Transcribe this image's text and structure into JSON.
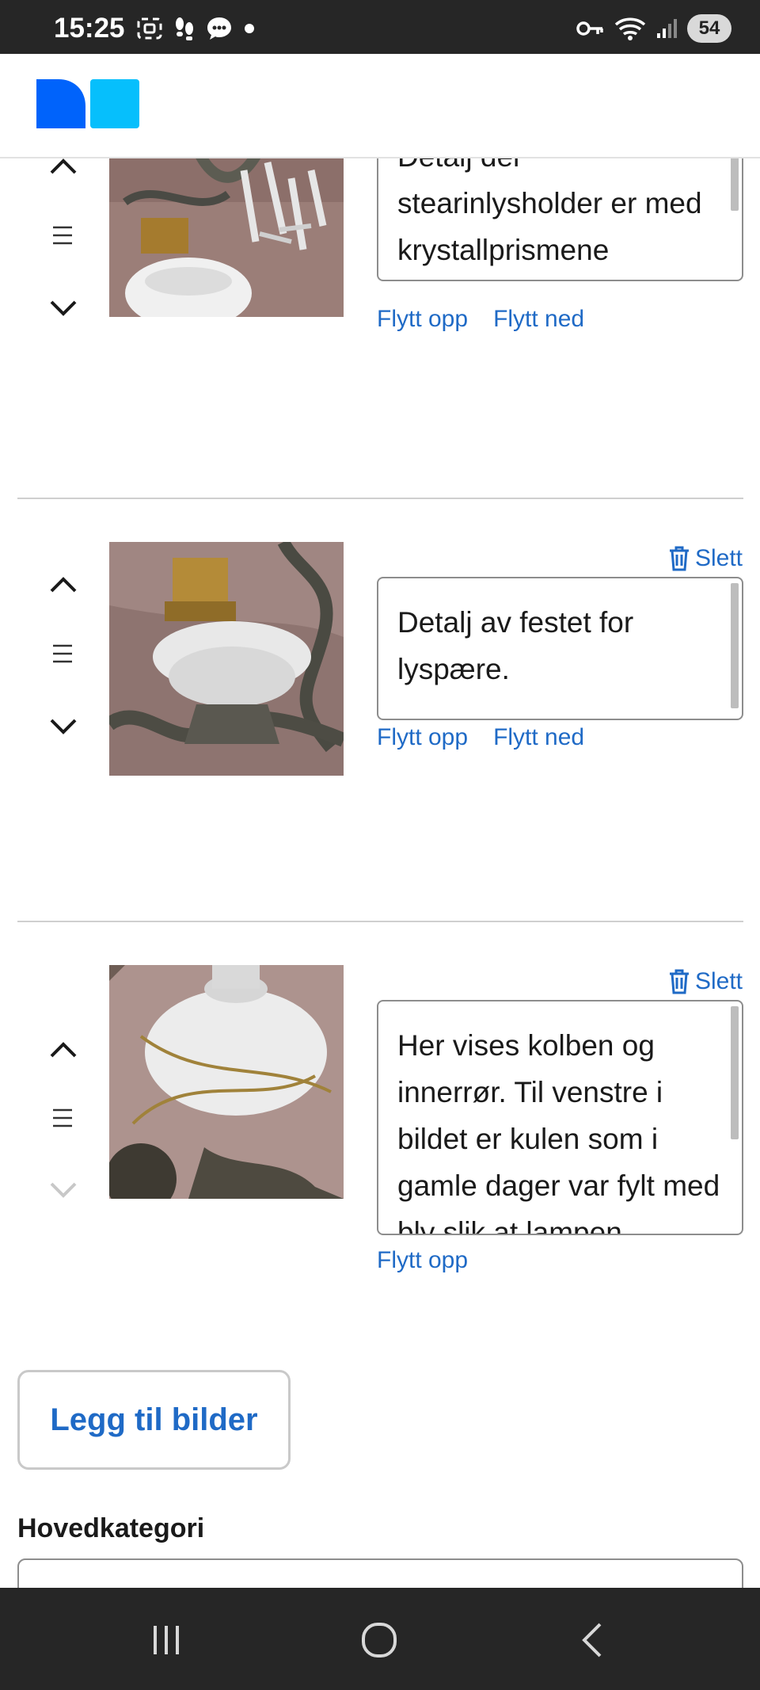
{
  "status_bar": {
    "time": "15:25",
    "battery": "54",
    "icons_left": [
      "screenshot-icon",
      "footsteps-icon",
      "chat-icon",
      "dot-icon"
    ],
    "icons_right": [
      "vpn-key-icon",
      "wifi-icon",
      "signal-icon",
      "battery-icon"
    ]
  },
  "header": {
    "logo_colors": [
      "#0063fb",
      "#06bffc"
    ]
  },
  "images": [
    {
      "caption": "Detalj der stearinlysholder er med krystallprismene",
      "move_up_label": "Flytt opp",
      "move_down_label": "Flytt ned",
      "up_enabled": true,
      "down_enabled": true
    },
    {
      "delete_label": "Slett",
      "caption": "Detalj av festet for lyspære.",
      "move_up_label": "Flytt opp",
      "move_down_label": "Flytt ned",
      "up_enabled": true,
      "down_enabled": true
    },
    {
      "delete_label": "Slett",
      "caption": "Her vises kolben og innerrør. Til venstre i bildet er kulen som i gamle dager var fylt med bly slik at lampen",
      "move_up_label": "Flytt opp",
      "up_enabled": true,
      "down_enabled": false
    }
  ],
  "add_images_button": "Legg til bilder",
  "main_category_label": "Hovedkategori",
  "colors": {
    "link": "#1f6ac6",
    "status_bar": "#262626",
    "divider": "#cfcfcf"
  },
  "nav_bar": {
    "buttons": [
      "recent-apps-icon",
      "home-icon",
      "back-icon"
    ]
  }
}
